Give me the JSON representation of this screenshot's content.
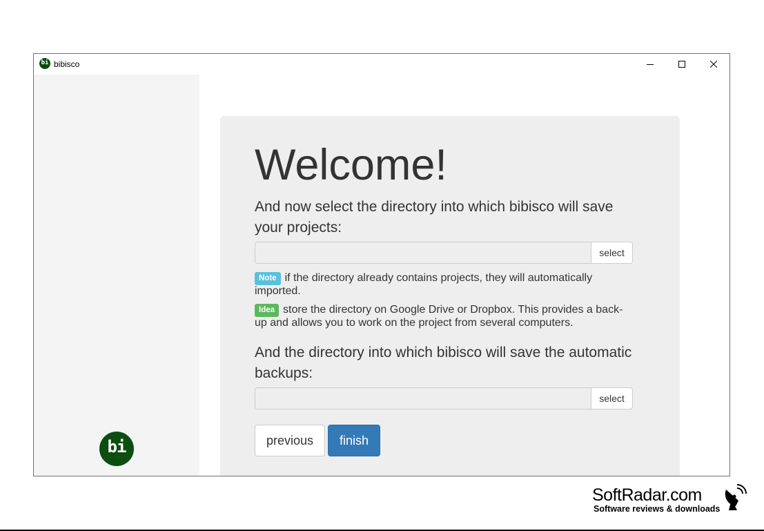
{
  "window": {
    "title": "bibisco",
    "app_icon_text": "bi"
  },
  "sidebar": {
    "logo_text": "bi"
  },
  "wizard": {
    "heading": "Welcome!",
    "projects_prompt": "And now select the directory into which bibisco will save your projects:",
    "projects_input_value": "",
    "projects_select_label": "select",
    "note_badge": "Note",
    "note_text": "if the directory already contains projects, they will automatically imported.",
    "idea_badge": "Idea",
    "idea_text": "store the directory on Google Drive or Dropbox. This provides a back-up and allows you to work on the project from several computers.",
    "backups_prompt": "And the directory into which bibisco will save the automatic backups:",
    "backups_input_value": "",
    "backups_select_label": "select",
    "previous_label": "previous",
    "finish_label": "finish"
  },
  "watermark": {
    "title": "SoftRadar.com",
    "subtitle": "Software reviews & downloads"
  },
  "colors": {
    "note": "#5bc0de",
    "idea": "#5cb85c",
    "primary": "#337ab7",
    "logo_bg": "#0b4e0f",
    "jumbotron": "#eeeeee",
    "sidebar": "#f4f4f4"
  }
}
